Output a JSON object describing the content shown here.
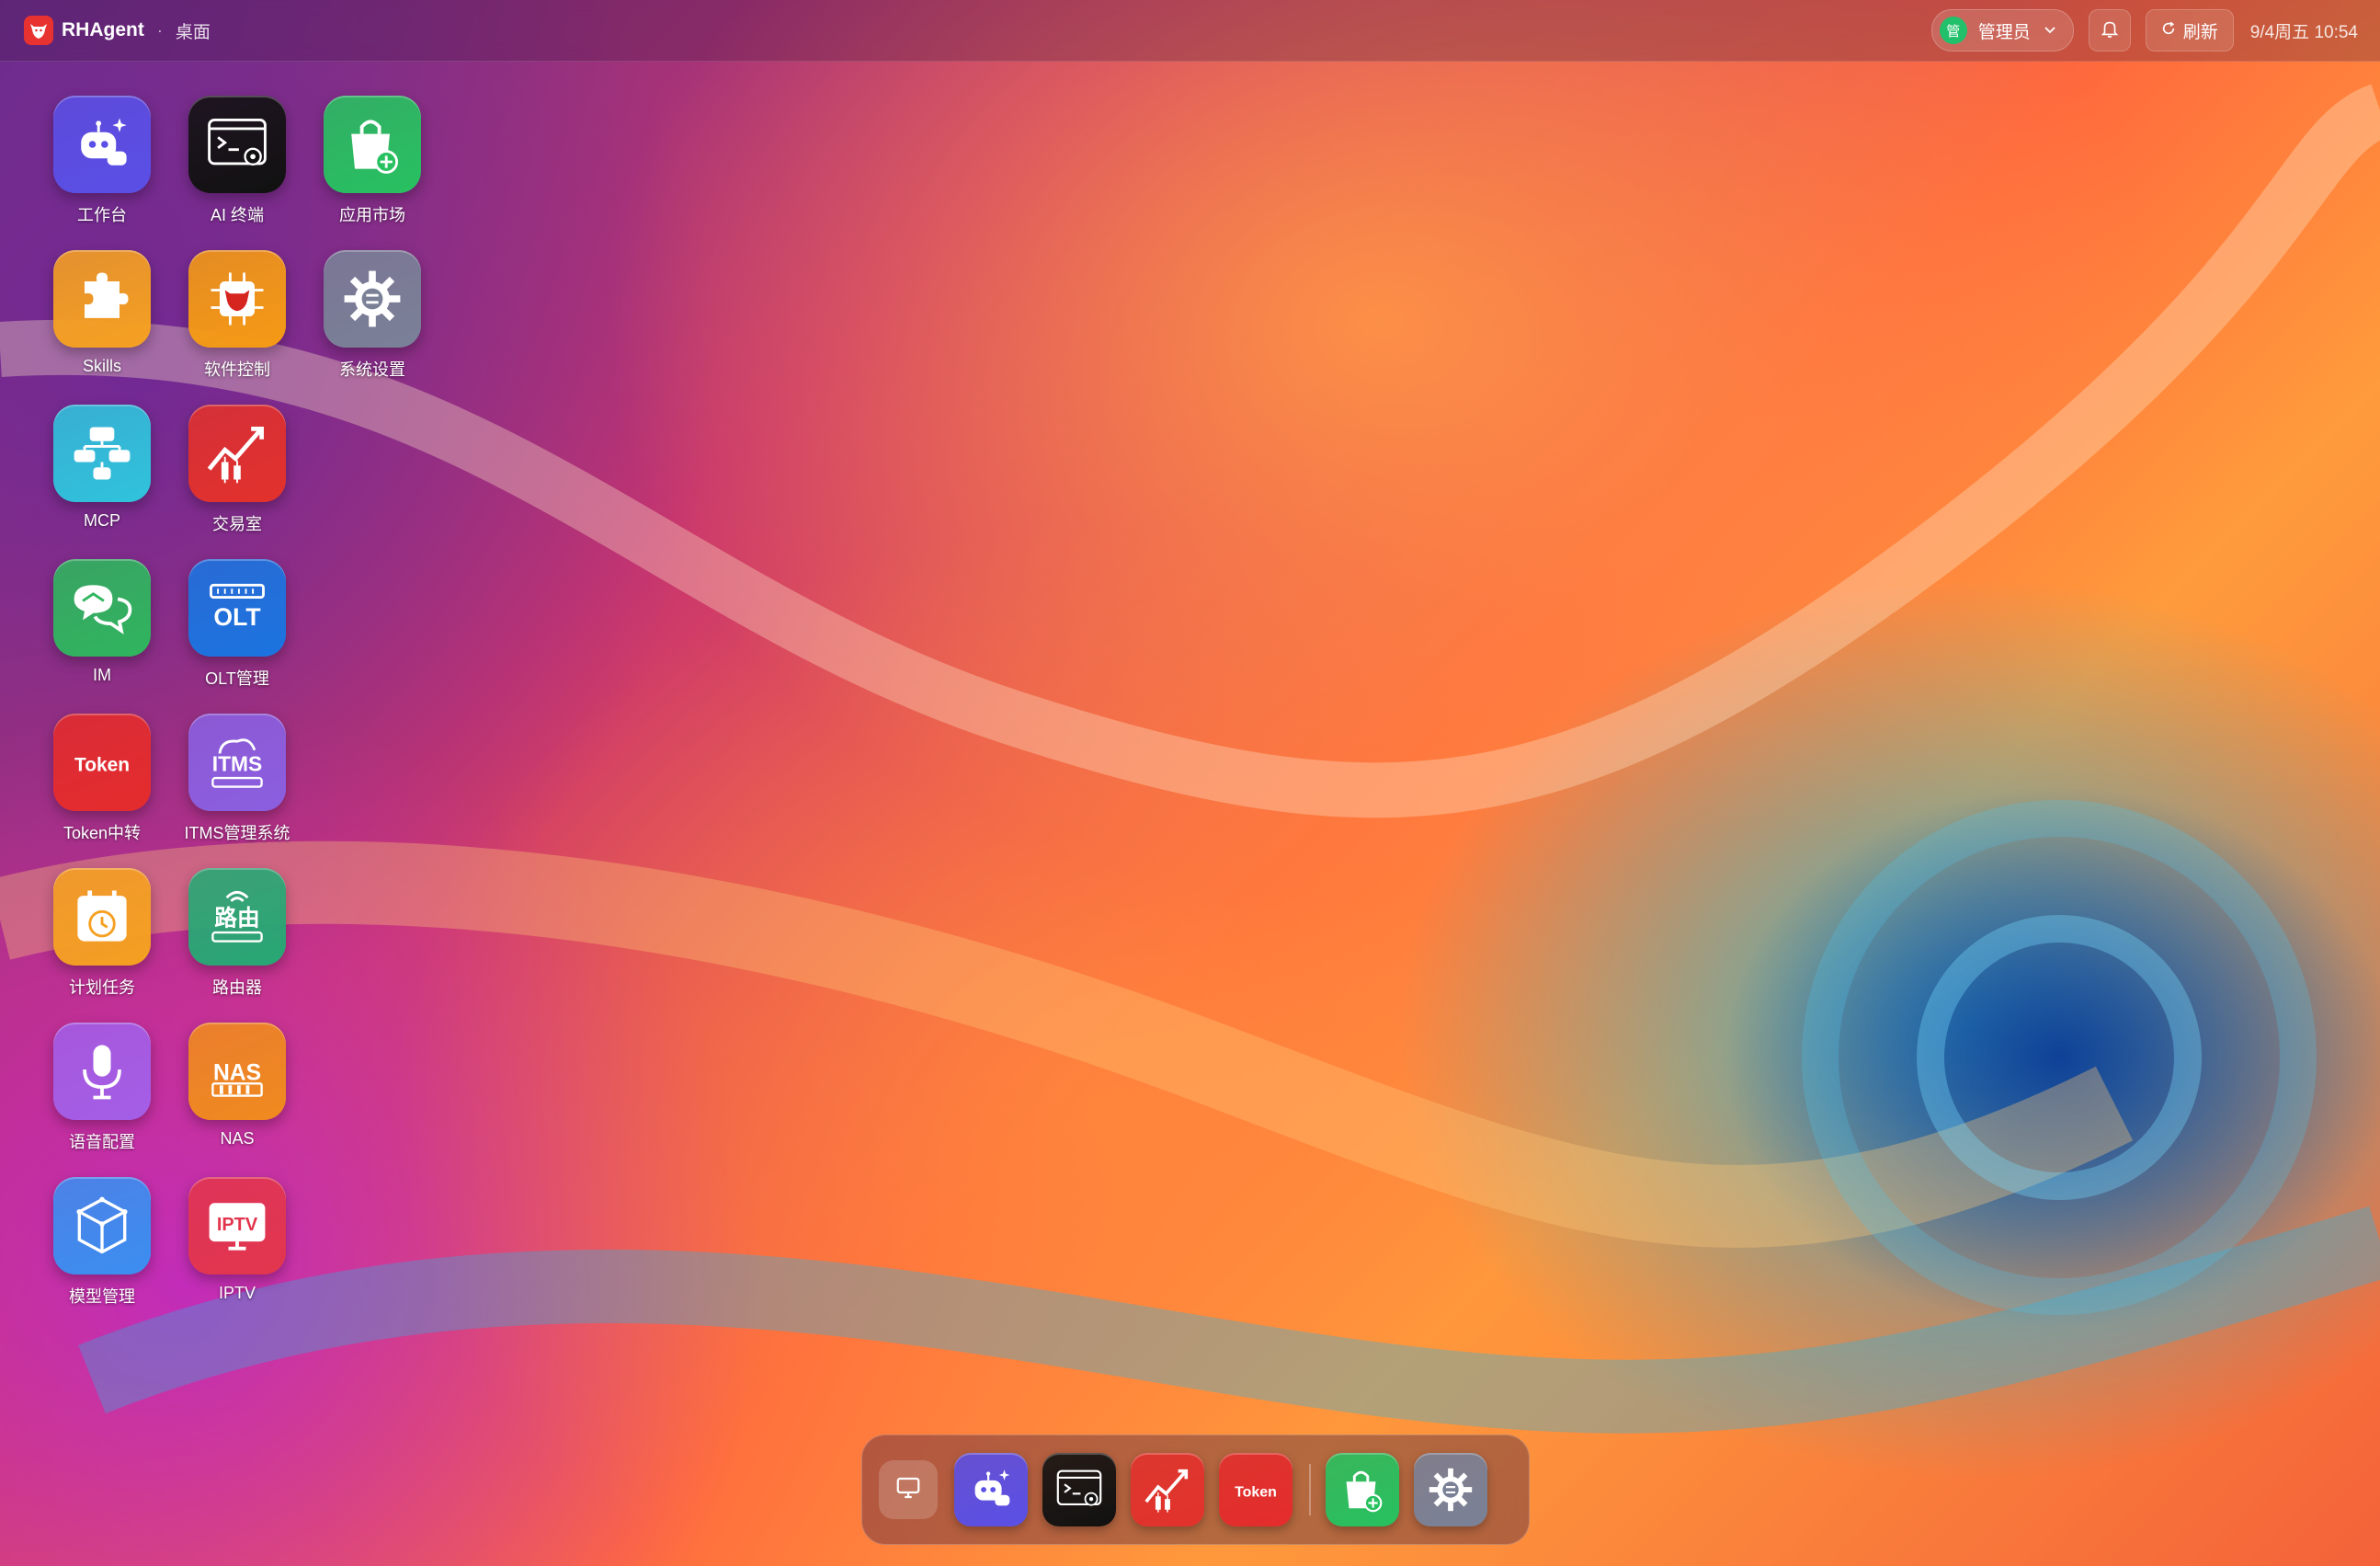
{
  "topbar": {
    "app_name": "RHAgent",
    "separator": "·",
    "breadcrumb": "桌面",
    "user": {
      "avatar_text": "管",
      "name": "管理员"
    },
    "refresh_label": "刷新",
    "datetime": "9/4周五 10:54"
  },
  "desktop": {
    "icons": [
      {
        "label": "工作台",
        "icon": "robot-assistant-icon",
        "color": "#5a4fe6"
      },
      {
        "label": "AI 终端",
        "icon": "terminal-icon",
        "color": "#111111"
      },
      {
        "label": "应用市场",
        "icon": "shopping-bag-icon",
        "color": "#27c160"
      },
      {
        "label": "Skills",
        "icon": "puzzle-icon",
        "color": "#f5a021"
      },
      {
        "label": "软件控制",
        "icon": "circuit-bull-icon",
        "color": "#f59a14"
      },
      {
        "label": "系统设置",
        "icon": "gear-icon",
        "color": "#7a8197"
      },
      {
        "label": "MCP",
        "icon": "plug-network-icon",
        "color": "#2fc3dc"
      },
      {
        "label": "交易室",
        "icon": "stock-chart-icon",
        "color": "#e2312c"
      },
      {
        "label": "IM",
        "icon": "chat-bubbles-icon",
        "color": "#2fb55e"
      },
      {
        "label": "OLT管理",
        "icon": "olt-device-icon",
        "color": "#1b74e0"
      },
      {
        "label": "Token中转",
        "icon": "token-relay-icon",
        "color": "#e42c2c",
        "glyph": "Token"
      },
      {
        "label": "ITMS管理系统",
        "icon": "itms-cloud-icon",
        "color": "#8a5fe0",
        "glyph": "ITMS"
      },
      {
        "label": "计划任务",
        "icon": "calendar-clock-icon",
        "color": "#f5a021"
      },
      {
        "label": "路由器",
        "icon": "router-icon",
        "color": "#27a874",
        "glyph": "路由"
      },
      {
        "label": "语音配置",
        "icon": "microphone-icon",
        "color": "#a35ee6"
      },
      {
        "label": "NAS",
        "icon": "nas-storage-icon",
        "color": "#f08a1e",
        "glyph": "NAS"
      },
      {
        "label": "模型管理",
        "icon": "cube-model-icon",
        "color": "#3b8ef0"
      },
      {
        "label": "IPTV",
        "icon": "iptv-tv-icon",
        "color": "#e2354d",
        "glyph": "IPTV"
      }
    ]
  },
  "dock": {
    "items": [
      {
        "name": "robot-assistant-icon",
        "color": "#5a4fe6"
      },
      {
        "name": "terminal-icon",
        "color": "#111111"
      },
      {
        "name": "stock-chart-icon",
        "color": "#e2312c"
      },
      {
        "name": "token-relay-icon",
        "color": "#e42c2c",
        "glyph": "Token"
      },
      {
        "name": "shopping-bag-icon",
        "color": "#27c160"
      },
      {
        "name": "gear-icon",
        "color": "#7a8197"
      }
    ]
  }
}
